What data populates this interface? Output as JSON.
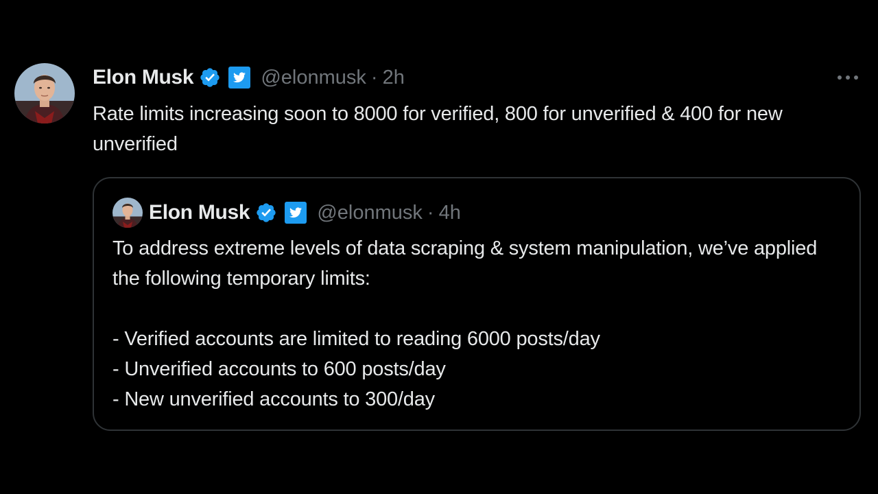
{
  "tweet": {
    "author_name": "Elon Musk",
    "handle": "@elonmusk",
    "separator": "·",
    "time": "2h",
    "text": "Rate limits increasing soon to 8000 for verified, 800 for unverified & 400 for new unverified",
    "more_icon": "more-horizontal-icon",
    "verified_icon": "verified-badge-icon",
    "affiliation_icon": "twitter-bird-icon"
  },
  "quoted_tweet": {
    "author_name": "Elon Musk",
    "handle": "@elonmusk",
    "separator": "·",
    "time": "4h",
    "paragraph1": "To address extreme levels of data scraping & system manipulation, we’ve applied the following temporary limits:",
    "lines": [
      "- Verified accounts are limited to reading 6000 posts/day",
      "- Unverified accounts to 600 posts/day",
      "- New unverified accounts to 300/day"
    ]
  },
  "colors": {
    "background": "#000000",
    "text_primary": "#e7e9ea",
    "text_secondary": "#71767b",
    "verified_blue": "#1d9bf0",
    "border": "#2f3336"
  }
}
